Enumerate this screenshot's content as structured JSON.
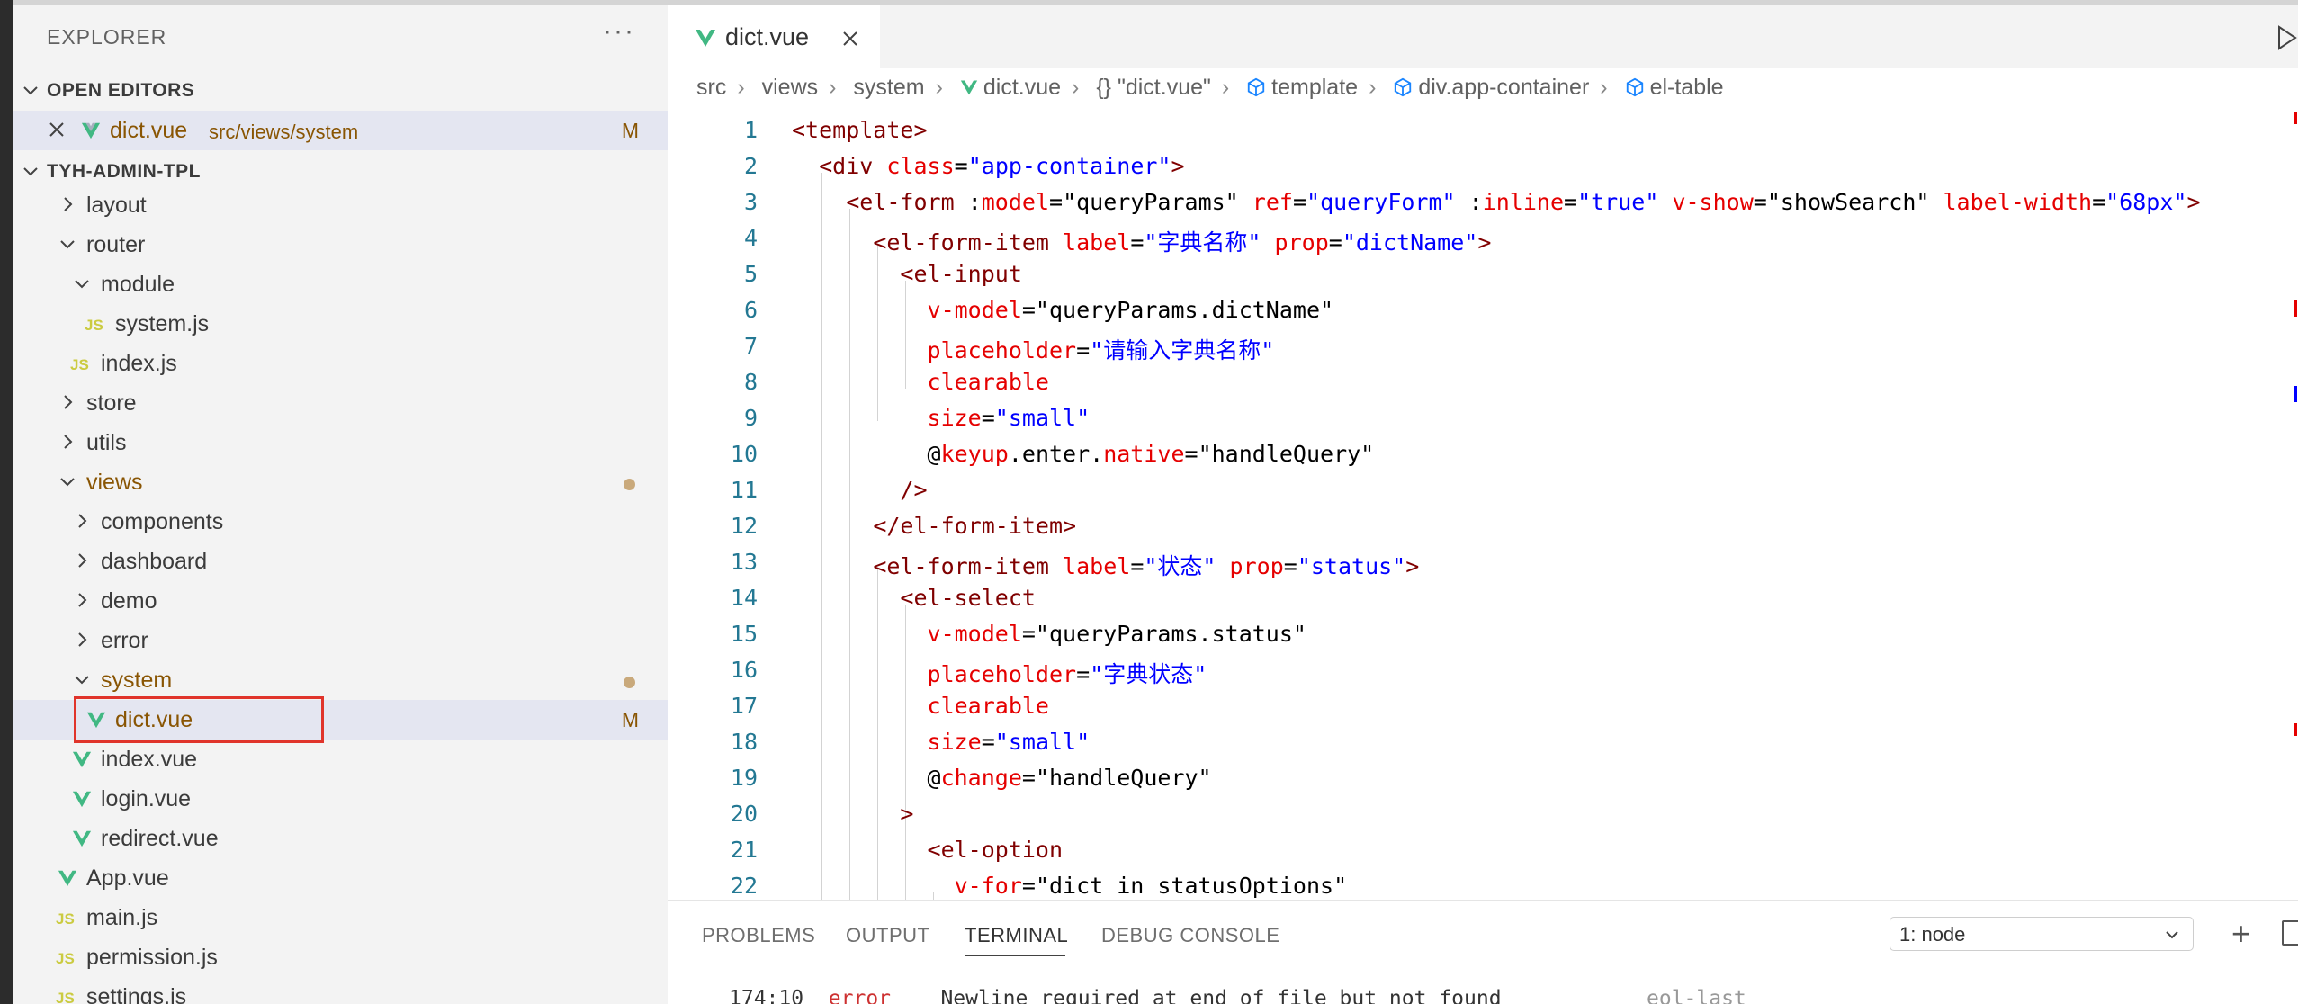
{
  "sidebar": {
    "title": "EXPLORER",
    "more": "···",
    "open_editors_label": "OPEN EDITORS",
    "open_editor": {
      "name": "dict.vue",
      "path": "src/views/system",
      "badge": "M"
    },
    "project_label": "TYH-ADMIN-TPL",
    "tree": [
      {
        "label": "layout"
      },
      {
        "label": "router"
      },
      {
        "label": "module"
      },
      {
        "label": "system.js"
      },
      {
        "label": "index.js"
      },
      {
        "label": "store"
      },
      {
        "label": "utils"
      },
      {
        "label": "views"
      },
      {
        "label": "components"
      },
      {
        "label": "dashboard"
      },
      {
        "label": "demo"
      },
      {
        "label": "error"
      },
      {
        "label": "system"
      },
      {
        "label": "dict.vue",
        "badge": "M"
      },
      {
        "label": "index.vue"
      },
      {
        "label": "login.vue"
      },
      {
        "label": "redirect.vue"
      },
      {
        "label": "App.vue"
      },
      {
        "label": "main.js"
      },
      {
        "label": "permission.js"
      },
      {
        "label": "settings.js"
      }
    ],
    "js_label": "JS"
  },
  "editor": {
    "tab_name": "dict.vue",
    "breadcrumb": [
      "src",
      "views",
      "system",
      "dict.vue",
      "{} \"dict.vue\"",
      "template",
      "div.app-container",
      "el-table"
    ],
    "line_numbers": [
      "1",
      "2",
      "3",
      "4",
      "5",
      "6",
      "7",
      "8",
      "9",
      "10",
      "11",
      "12",
      "13",
      "14",
      "15",
      "16",
      "17",
      "18",
      "19",
      "20",
      "21",
      "22"
    ]
  },
  "panel": {
    "tabs": [
      "PROBLEMS",
      "OUTPUT",
      "TERMINAL",
      "DEBUG CONSOLE"
    ],
    "terminal_select": "1: node",
    "term_pos": "174:10",
    "term_level": "error",
    "term_message": "Newline required at end of file but not found",
    "term_rule": "eol-last"
  },
  "colors": {
    "tag": "#800000",
    "attribute": "#e50000",
    "value": "#0000ff",
    "line_number": "#237893",
    "modified": "#895503",
    "vue_green": "#41b883",
    "highlight_box": "#e0342b"
  }
}
